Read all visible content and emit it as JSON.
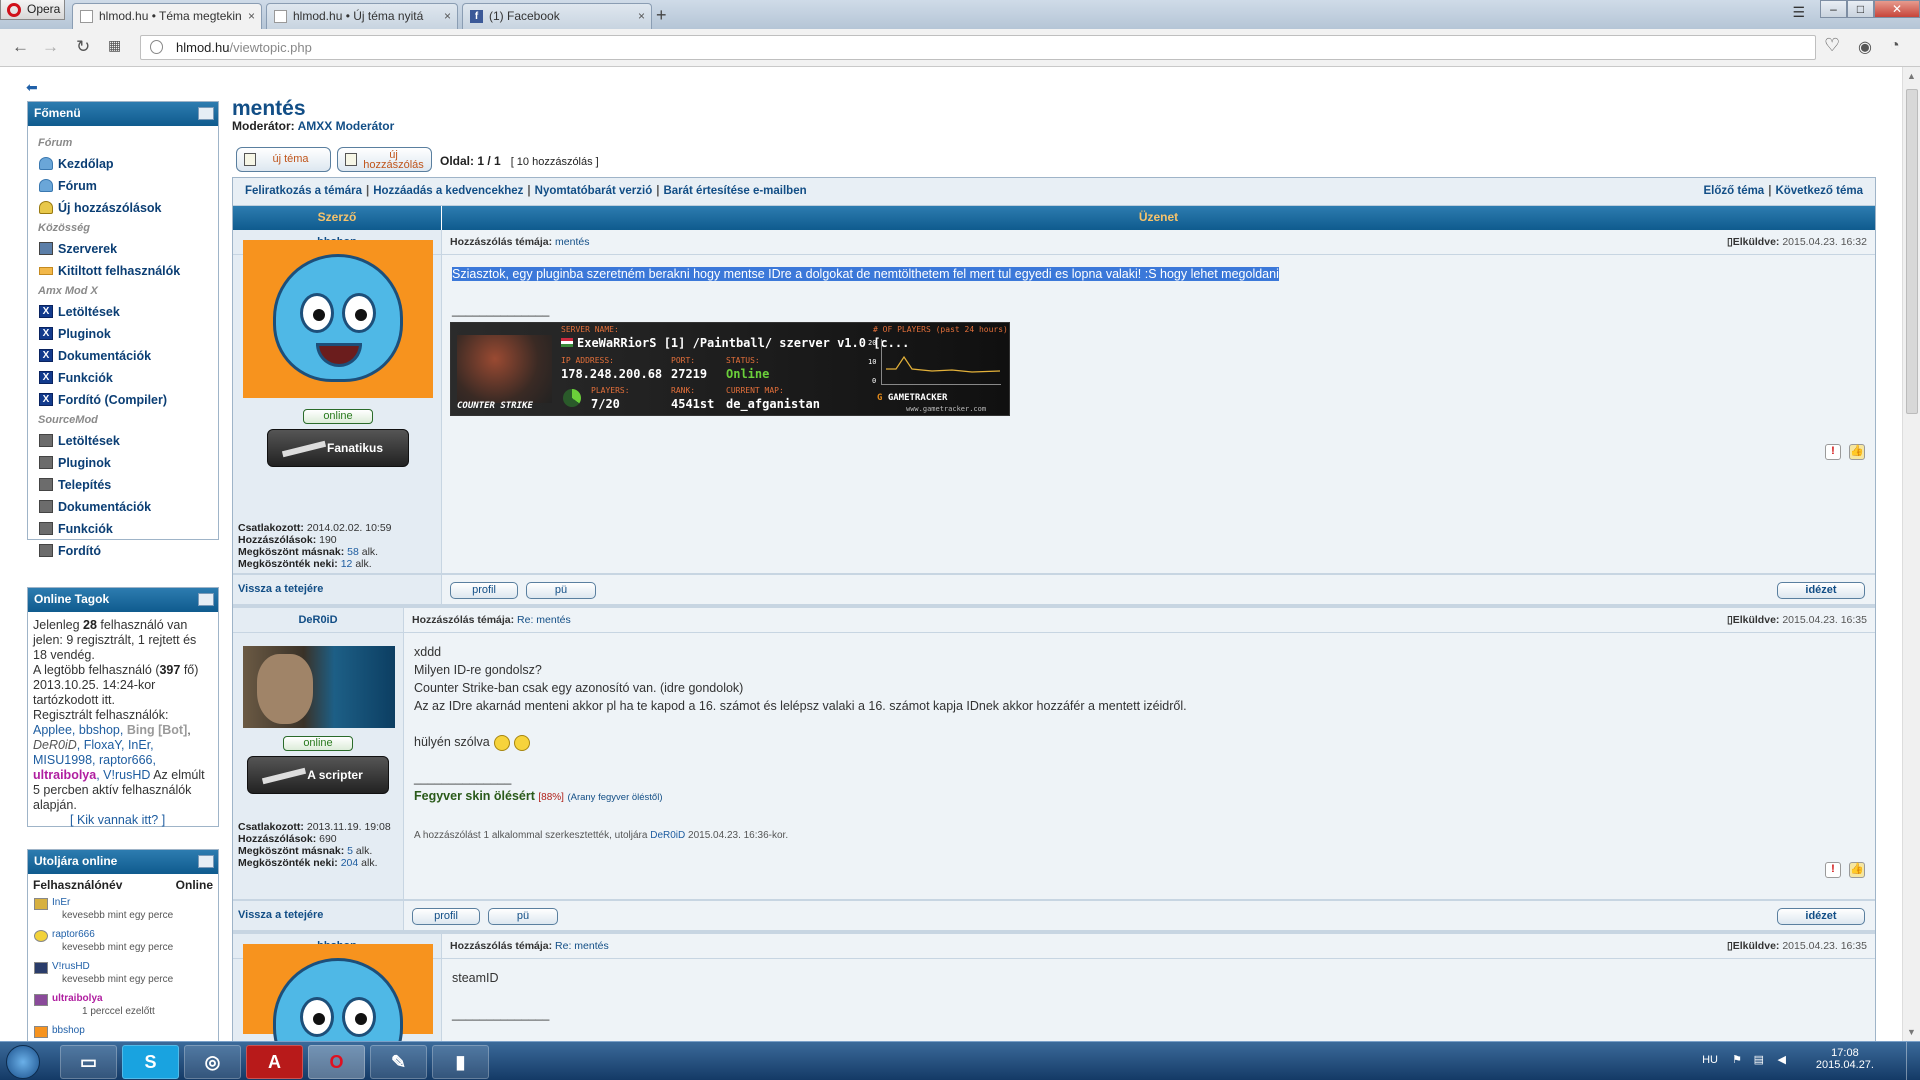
{
  "browser": {
    "menu_label": "Opera",
    "tabs": [
      {
        "title": "hlmod.hu • Téma megtekin"
      },
      {
        "title": "hlmod.hu • Új téma nyitá"
      },
      {
        "title": "(1) Facebook"
      }
    ],
    "url_host": "hlmod.hu",
    "url_path": "/viewtopic.php"
  },
  "sidebar": {
    "main_menu_title": "Főmenü",
    "sections": {
      "forum": "Fórum",
      "community": "Közösség",
      "amx": "Amx Mod X",
      "sourcemod": "SourceMod"
    },
    "forum_items": [
      "Kezdőlap",
      "Fórum",
      "Új hozzászólások"
    ],
    "community_items": [
      "Szerverek",
      "Kitiltott felhasználók"
    ],
    "amx_items": [
      "Letöltések",
      "Pluginok",
      "Dokumentációk",
      "Funkciók",
      "Fordító (Compiler)"
    ],
    "sm_items": [
      "Letöltések",
      "Pluginok",
      "Telepítés",
      "Dokumentációk",
      "Funkciók",
      "Fordító"
    ],
    "online_title": "Online Tagok",
    "online_text": {
      "p1": "Jelenleg ",
      "count": "28",
      "p2": " felhasználó van jelen: 9 regisztrált, 1 rejtett és 18 vendég.",
      "p3": "A legtöbb felhasználó (",
      "max": "397",
      "p4": " fő) 2013.10.25. 14:24-kor tartózkodott itt.",
      "p5": "Regisztrált felhasználók:",
      "users1": "Applee, bbshop,",
      "bot": "Bing [Bot]",
      "users2": ",",
      "italic": "DeR0iD",
      "users3": ", FloxaY, InEr, MISU1998, raptor666,",
      "mod": "ultraibolya",
      "users4": ", V!rusHD",
      "p6": "Az elmúlt 5 percben aktív felhasználók alapján.",
      "who": "[ Kik vannak itt? ]"
    },
    "last_title": "Utoljára online",
    "last_cols": [
      "Felhasználónév",
      "Online"
    ],
    "last_users": [
      {
        "name": "InEr",
        "time": "kevesebb mint egy perce"
      },
      {
        "name": "raptor666",
        "time": "kevesebb mint egy perce"
      },
      {
        "name": "V!rusHD",
        "time": "kevesebb mint egy perce"
      },
      {
        "name": "ultraibolya",
        "time": "1 perccel ezelőtt"
      },
      {
        "name": "bbshop",
        "time": ""
      }
    ]
  },
  "topic": {
    "title": "mentés",
    "moderator_label": "Moderátor:",
    "moderator": "AMXX Moderátor",
    "new_topic": "új téma",
    "new_reply": "új hozzászólás",
    "pages": "Oldal: 1 / 1",
    "count": "[ 10 hozzászólás ]",
    "tools": [
      "Feliratkozás a témára",
      "Hozzáadás a kedvencekhez",
      "Nyomtatóbarát verzió",
      "Barát értesítése e-mailben"
    ],
    "prev": "Előző téma",
    "next": "Következő téma",
    "col_author": "Szerző",
    "col_message": "Üzenet",
    "subject_label": "Hozzászólás témája:",
    "sent_label": "Elküldve:",
    "back_top": "Vissza a tetejére",
    "profile": "profil",
    "pm": "pü",
    "quote": "idézet",
    "online_badge": "online"
  },
  "posts": [
    {
      "author": "bbshop",
      "subject": "mentés",
      "date": "2015.04.23. 16:32",
      "text": "Sziasztok, egy pluginba szeretném berakni hogy mentse IDre a dolgokat de nemtölthetem fel mert tul egyedi es lopna valaki! :S hogy lehet megoldani",
      "sig_line": "______________",
      "rank": "Fanatikus",
      "joined_label": "Csatlakozott:",
      "joined": "2014.02.02. 10:59",
      "posts_label": "Hozzászólások:",
      "posts": "190",
      "thanks_given_label": "Megköszönt másnak:",
      "thanks_given": "58",
      "thanks_recv_label": "Megköszönték neki:",
      "thanks_recv": "12",
      "times": "alk."
    },
    {
      "author": "DeR0iD",
      "subject": "Re: mentés",
      "date": "2015.04.23. 16:35",
      "lines": [
        "xddd",
        "Milyen ID-re gondolsz?",
        "Counter Strike-ban csak egy azonosító van. (idre gondolok)",
        "Az az IDre akarnád menteni akkor pl ha te kapod a 16. számot és lelépsz valaki a 16. számot kapja IDnek akkor hozzáfér a mentett izéidről."
      ],
      "closing": "hülyén szólva",
      "sig_line": "______________",
      "sig_main": "Fegyver skin ölésért",
      "sig_pct": "[88%]",
      "sig_small": "(Arany fegyver öléstől)",
      "edit_pre": "A hozzászólást 1 alkalommal szerkesztették, utoljára",
      "edit_user": "DeR0iD",
      "edit_post": "2015.04.23. 16:36-kor.",
      "rank": "A scripter",
      "joined": "2013.11.19. 19:08",
      "posts": "690",
      "thanks_given": "5",
      "thanks_recv": "204"
    },
    {
      "author": "bbshop",
      "subject": "Re: mentés",
      "date": "2015.04.23. 16:35",
      "text": "steamID",
      "sig_line": "______________"
    }
  ],
  "gametracker": {
    "server_name_label": "SERVER NAME:",
    "server_name": "ExeWaRRiorS [1] /Paintball/ szerver v1.0 [c...",
    "players_past_label": "# OF PLAYERS (past 24 hours)",
    "ip_label": "IP ADDRESS:",
    "ip": "178.248.200.68",
    "port_label": "PORT:",
    "port": "27219",
    "status_label": "STATUS:",
    "status": "Online",
    "players_label": "PLAYERS:",
    "players": "7/20",
    "rank_label": "RANK:",
    "rank": "4541st",
    "map_label": "CURRENT MAP:",
    "map": "de_afganistan",
    "game": "COUNTER STRIKE",
    "brand": "GAMETRACKER",
    "brand_url": "www.gametracker.com",
    "graph_ticks": [
      "20",
      "10",
      "0"
    ]
  },
  "taskbar": {
    "lang": "HU",
    "time": "17:08",
    "date": "2015.04.27."
  }
}
